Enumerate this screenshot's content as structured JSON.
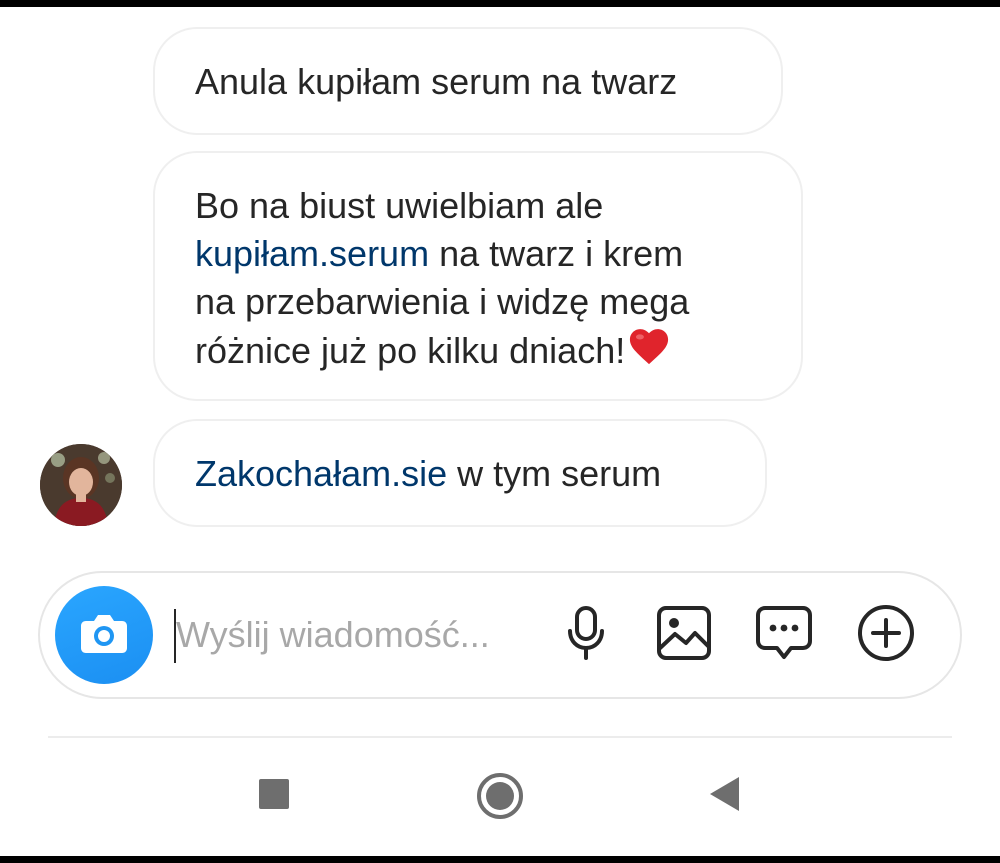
{
  "messages": [
    {
      "parts": [
        {
          "text": "Anula kupiłam serum na twarz",
          "link": false
        }
      ]
    },
    {
      "lines": [
        [
          {
            "text": "Bo na biust uwielbiam ale",
            "link": false
          }
        ],
        [
          {
            "text": "kupiłam.serum",
            "link": true
          },
          {
            "text": " na twarz i krem",
            "link": false
          }
        ],
        [
          {
            "text": "na przebarwienia i widzę mega",
            "link": false
          }
        ],
        [
          {
            "text": "różnice już po kilku dniach!",
            "link": false
          }
        ]
      ],
      "emoji": "red-heart"
    },
    {
      "parts": [
        {
          "text": "Zakochałam.sie",
          "link": true
        },
        {
          "text": " w tym serum",
          "link": false
        }
      ]
    }
  ],
  "composer": {
    "placeholder": "Wyślij wiadomość...",
    "icons": [
      "camera-icon",
      "microphone-icon",
      "gallery-icon",
      "sticker-icon",
      "plus-icon"
    ]
  },
  "nav_bar": {
    "icons": [
      "recent-apps-icon",
      "home-icon",
      "back-icon"
    ]
  },
  "colors": {
    "link": "#00376b",
    "camera_button": "#1f96f3",
    "bubble_border": "#efefef",
    "heart": "#e0242c"
  }
}
